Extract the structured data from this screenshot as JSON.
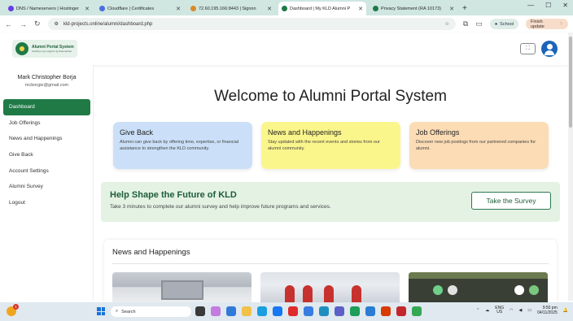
{
  "browser": {
    "tabs": [
      {
        "title": "DNS / Nameservers | Hostinger",
        "favicon_color": "#673de6",
        "active": false
      },
      {
        "title": "Cloudflare | Certificates",
        "favicon_color": "#4a6ee0",
        "active": false
      },
      {
        "title": "72.60.195.166:8443 | Signon",
        "favicon_color": "#d98a2b",
        "active": false
      },
      {
        "title": "Dashboard | My KLD Alumni P",
        "favicon_color": "#1f7a46",
        "active": true
      },
      {
        "title": "Privacy Statement (RA 10173)",
        "favicon_color": "#1f7a46",
        "active": false
      }
    ],
    "new_tab": "+",
    "window_controls": [
      "—",
      "☐",
      "✕"
    ],
    "url": "kld-projects.online/alumni/dashboard.php",
    "profile_chip": "School",
    "update_chip": "Finish update"
  },
  "header": {
    "logo_title": "Alumni Portal System",
    "logo_subtitle": "Kolehiyo ng Lungsod ng Dasmariñas",
    "fullscreen_icon": "⛶"
  },
  "sidebar": {
    "user_name": "Mark Christopher Borja",
    "user_email": "mcborgie@gmail.com",
    "items": [
      {
        "label": "Dashboard",
        "active": true
      },
      {
        "label": "Job Offerings",
        "active": false
      },
      {
        "label": "News and Happenings",
        "active": false
      },
      {
        "label": "Give Back",
        "active": false
      },
      {
        "label": "Account Settings",
        "active": false
      },
      {
        "label": "Alumni Survey",
        "active": false
      },
      {
        "label": "Logout",
        "active": false
      }
    ]
  },
  "main": {
    "welcome": "Welcome to Alumni Portal System",
    "cards": [
      {
        "title": "Give Back",
        "desc": "Alumni can give back by offering time, expertise, or financial assistance to strengthen the KLD community.",
        "color": "#cbe0f8"
      },
      {
        "title": "News and Happenings",
        "desc": "Stay updated with the recent events and stories from our alumni community.",
        "color": "#fbf68c"
      },
      {
        "title": "Job Offerings",
        "desc": "Discover new job postings from our partnered companies for alumni.",
        "color": "#fcdcb5"
      }
    ],
    "banner": {
      "title": "Help Shape the Future of KLD",
      "desc": "Take 3 minutes to complete our alumni survey and help improve future programs and services.",
      "button": "Take the Survey"
    },
    "news_section_title": "News and Happenings"
  },
  "taskbar": {
    "search_placeholder": "Search",
    "weather_badge": "1",
    "lang_top": "ENG",
    "lang_bottom": "US",
    "time": "9:50 pm",
    "date": "04/11/2025"
  },
  "colors": {
    "brand_green": "#1f7a46",
    "banner_bg": "#e4f2e4"
  }
}
